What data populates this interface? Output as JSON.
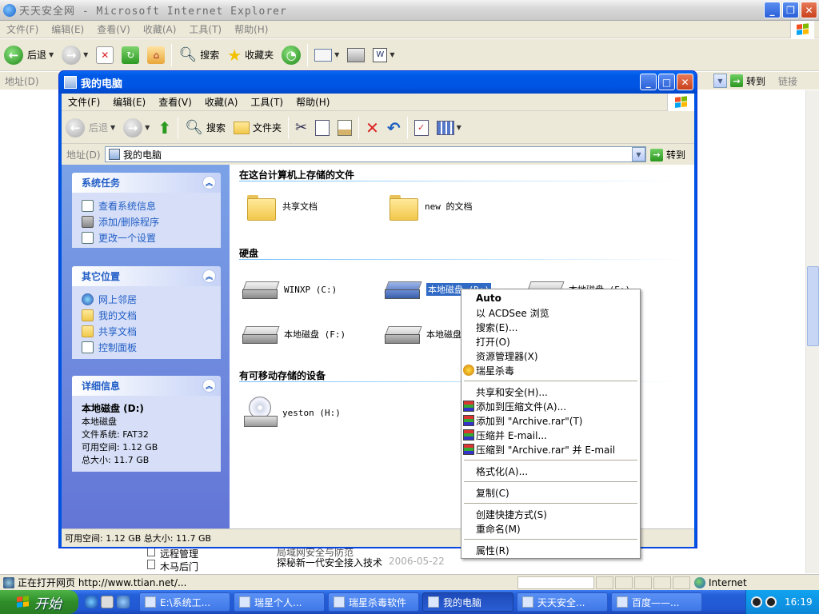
{
  "ie": {
    "title": "天天安全网 - Microsoft Internet Explorer",
    "menu": [
      "文件(F)",
      "编辑(E)",
      "查看(V)",
      "收藏(A)",
      "工具(T)",
      "帮助(H)"
    ],
    "toolbar": {
      "back": "后退",
      "search": "搜索",
      "favorites": "收藏夹"
    },
    "address_label": "地址(D)",
    "goto": "转到",
    "links": "链接",
    "status_text": "正在打开网页 http://www.ttian.net/...",
    "zone": "Internet",
    "background_lines": [
      "远程管理",
      "木马后门",
      "局域网安全与防范",
      "探秘新一代安全接入技术",
      "2006-05-22"
    ]
  },
  "window": {
    "title": "我的电脑",
    "menu": [
      "文件(F)",
      "编辑(E)",
      "查看(V)",
      "收藏(A)",
      "工具(T)",
      "帮助(H)"
    ],
    "toolbar": {
      "back": "后退",
      "search": "搜索",
      "folders": "文件夹"
    },
    "address_label": "地址(D)",
    "address_value": "我的电脑",
    "goto": "转到",
    "status": "可用空间: 1.12 GB 总大小: 11.7 GB"
  },
  "tasks": {
    "system": {
      "title": "系统任务",
      "items": [
        "查看系统信息",
        "添加/删除程序",
        "更改一个设置"
      ]
    },
    "places": {
      "title": "其它位置",
      "items": [
        "网上邻居",
        "我的文档",
        "共享文档",
        "控制面板"
      ]
    },
    "details": {
      "title": "详细信息",
      "name": "本地磁盘 (D:)",
      "type": "本地磁盘",
      "fs": "文件系统: FAT32",
      "free": "可用空间: 1.12 GB",
      "total": "总大小: 11.7 GB"
    }
  },
  "content": {
    "group_files": "在这台计算机上存储的文件",
    "files": [
      "共享文档",
      "new 的文档"
    ],
    "group_drives": "硬盘",
    "drives": [
      "WINXP (C:)",
      "本地磁盘 (D:)",
      "本地磁盘 (E:)",
      "本地磁盘 (F:)",
      "本地磁盘"
    ],
    "group_removable": "有可移动存储的设备",
    "removable": [
      "yeston (H:)"
    ]
  },
  "context_menu": {
    "items": [
      "Auto",
      "以 ACDSee 浏览",
      "搜索(E)...",
      "打开(O)",
      "资源管理器(X)",
      "瑞星杀毒",
      "共享和安全(H)...",
      "添加到压缩文件(A)...",
      "添加到 \"Archive.rar\"(T)",
      "压缩并 E-mail...",
      "压缩到 \"Archive.rar\" 并 E-mail",
      "格式化(A)...",
      "复制(C)",
      "创建快捷方式(S)",
      "重命名(M)",
      "属性(R)"
    ]
  },
  "taskbar": {
    "start": "开始",
    "tasks": [
      "E:\\系统工...",
      "瑞星个人...",
      "瑞星杀毒软件",
      "我的电脑",
      "天天安全...",
      "百度——..."
    ],
    "clock": "16:19"
  }
}
